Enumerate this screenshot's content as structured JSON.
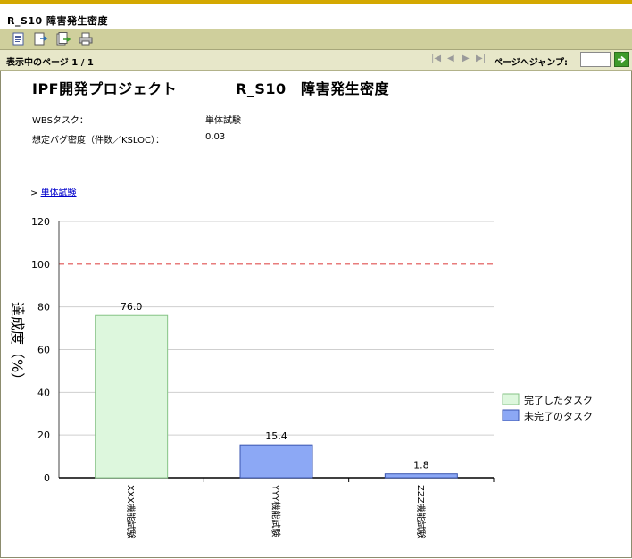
{
  "window": {
    "title": "R_S10  障害発生密度"
  },
  "toolbar": {
    "icons": [
      "report-view-icon",
      "export-icon",
      "export-all-icon",
      "print-icon"
    ]
  },
  "pagebar": {
    "page_info": "表示中のページ  1 / 1",
    "jump_label": "ページへジャンプ:",
    "jump_value": ""
  },
  "report": {
    "project": "IPF開発プロジェクト",
    "subtitle": "R_S10　障害発生密度",
    "fields": [
      {
        "label": "WBSタスク：",
        "value": "単体試験"
      },
      {
        "label": "想定バグ密度（件数／KSLOC）：",
        "value": "0.03"
      }
    ],
    "breadcrumb_prefix": "> ",
    "breadcrumb_link": "単体試験"
  },
  "colors": {
    "completed": "#ddf7dd",
    "completed_border": "#86c386",
    "incomplete": "#8ca8f5",
    "incomplete_border": "#3a55b0",
    "threshold": "#e05050"
  },
  "chart_data": {
    "type": "bar",
    "ylabel": "達成度（%）",
    "ylim": [
      0,
      120
    ],
    "yticks": [
      0,
      20,
      40,
      60,
      80,
      100,
      120
    ],
    "threshold": 100,
    "categories": [
      "XXX機能試験",
      "YYY機能試験",
      "ZZZ機能試験"
    ],
    "values": [
      76.0,
      15.4,
      1.8
    ],
    "value_labels": [
      "76.0",
      "15.4",
      "1.8"
    ],
    "bar_series": [
      "completed",
      "incomplete",
      "incomplete"
    ],
    "legend": [
      {
        "name": "完了したタスク",
        "color": "#ddf7dd"
      },
      {
        "name": "未完了のタスク",
        "color": "#8ca8f5"
      }
    ],
    "legend_position": "right",
    "grid": true
  }
}
